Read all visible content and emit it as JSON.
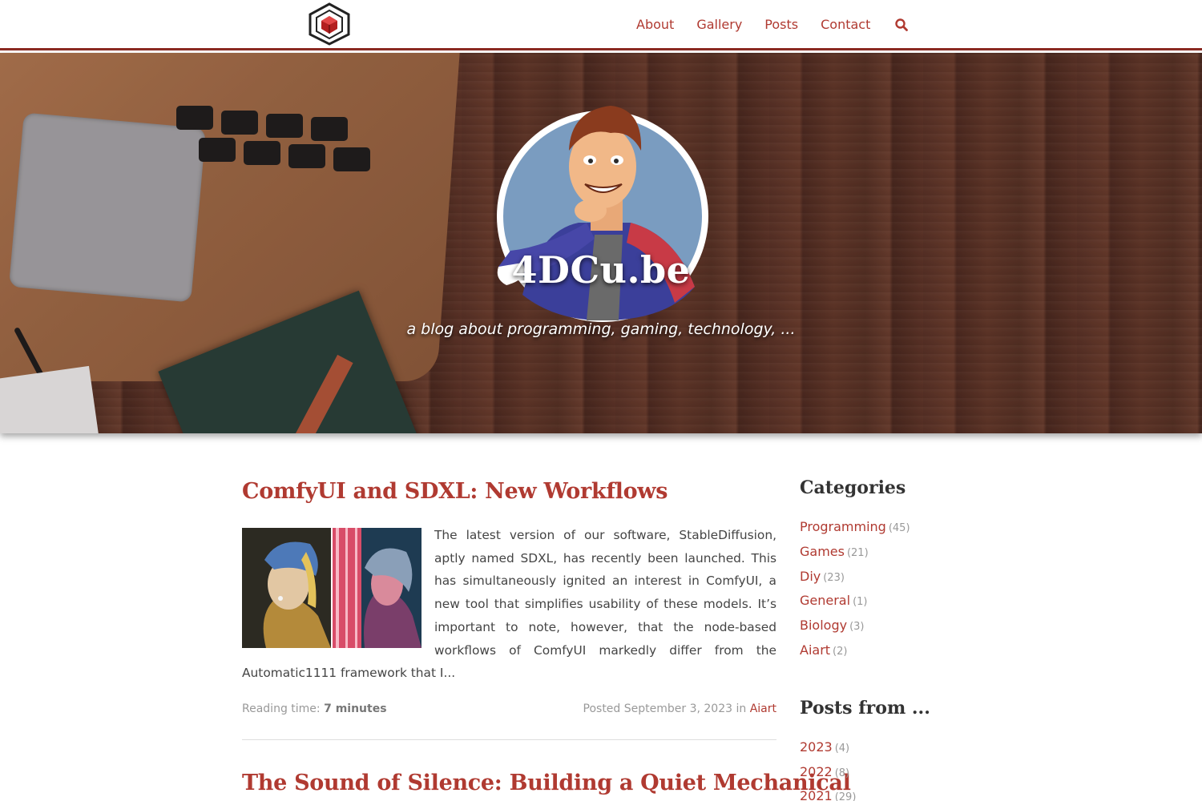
{
  "nav": {
    "logo_icon": "cube-hexagon-logo",
    "items": [
      "About",
      "Gallery",
      "Posts",
      "Contact"
    ],
    "search_icon": "search-icon",
    "accent": "#b03a31"
  },
  "hero": {
    "title": "4DCu.be",
    "tagline": "a blog about programming, gaming, technology, ..."
  },
  "posts": [
    {
      "title": "ComfyUI and SDXL: New Workflows",
      "excerpt": "The latest version of our software, StableDiffusion, aptly named SDXL, has recently been launched. This has simultaneously ignited an interest in ComfyUI, a new tool that simplifies usability of these models. It’s important to note, however, that the node-based workflows of ComfyUI markedly differ from the Automatic1111 framework that I...",
      "reading_label": "Reading time:",
      "reading_time": "7 minutes",
      "posted_label": "Posted September 3, 2023 in",
      "category": "Aiart"
    },
    {
      "title": "The Sound of Silence: Building a Quiet Mechanical"
    }
  ],
  "sidebar": {
    "categories_heading": "Categories",
    "categories": [
      {
        "name": "Programming",
        "count": "(45)"
      },
      {
        "name": "Games",
        "count": "(21)"
      },
      {
        "name": "Diy",
        "count": "(23)"
      },
      {
        "name": "General",
        "count": "(1)"
      },
      {
        "name": "Biology",
        "count": "(3)"
      },
      {
        "name": "Aiart",
        "count": "(2)"
      }
    ],
    "years_heading": "Posts from ...",
    "years": [
      {
        "name": "2023",
        "count": "(4)"
      },
      {
        "name": "2022",
        "count": "(8)"
      },
      {
        "name": "2021",
        "count": "(29)"
      }
    ]
  }
}
